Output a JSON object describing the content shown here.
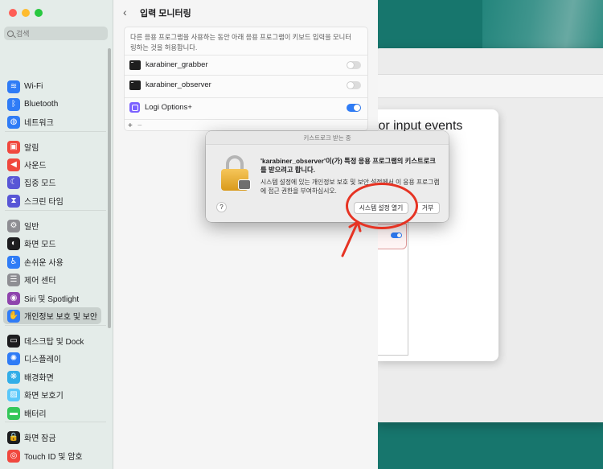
{
  "background": {
    "sheet_title": "tor input events"
  },
  "sidebar": {
    "search_placeholder": "검색",
    "items": [
      {
        "label": "Wi-Fi",
        "icon": "wifi-icon",
        "color": "#2f7cf6",
        "glyph": "≋"
      },
      {
        "label": "Bluetooth",
        "icon": "bluetooth-icon",
        "color": "#2f7cf6",
        "glyph": "ᛒ"
      },
      {
        "label": "네트워크",
        "icon": "network-icon",
        "color": "#2f7cf6",
        "glyph": "◍"
      },
      {
        "label": "알림",
        "icon": "notifications-icon",
        "color": "#f0483e",
        "glyph": "▣"
      },
      {
        "label": "사운드",
        "icon": "sound-icon",
        "color": "#f0483e",
        "glyph": "◀"
      },
      {
        "label": "집중 모드",
        "icon": "focus-icon",
        "color": "#5856d6",
        "glyph": "☾"
      },
      {
        "label": "스크린 타임",
        "icon": "screen-time-icon",
        "color": "#5856d6",
        "glyph": "⧗"
      },
      {
        "label": "일반",
        "icon": "general-icon",
        "color": "#8e8e93",
        "glyph": "⚙"
      },
      {
        "label": "화면 모드",
        "icon": "appearance-icon",
        "color": "#1d1d1f",
        "glyph": "◐"
      },
      {
        "label": "손쉬운 사용",
        "icon": "accessibility-icon",
        "color": "#2f7cf6",
        "glyph": "♿"
      },
      {
        "label": "제어 센터",
        "icon": "control-center-icon",
        "color": "#8e8e93",
        "glyph": "☰"
      },
      {
        "label": "Siri 및 Spotlight",
        "icon": "siri-icon",
        "color": "#8e44ad",
        "glyph": "◉"
      },
      {
        "label": "개인정보 보호 및 보안",
        "icon": "privacy-hand-icon",
        "color": "#2f7cf6",
        "glyph": "✋"
      },
      {
        "label": "데스크탑 및 Dock",
        "icon": "desktop-dock-icon",
        "color": "#1d1d1f",
        "glyph": "▭"
      },
      {
        "label": "디스플레이",
        "icon": "display-icon",
        "color": "#2f7cf6",
        "glyph": "✺"
      },
      {
        "label": "배경화면",
        "icon": "wallpaper-icon",
        "color": "#32aee8",
        "glyph": "❋"
      },
      {
        "label": "화면 보호기",
        "icon": "screensaver-icon",
        "color": "#5ac8fa",
        "glyph": "▨"
      },
      {
        "label": "배터리",
        "icon": "battery-icon",
        "color": "#34c759",
        "glyph": "▬"
      },
      {
        "label": "화면 잠금",
        "icon": "lock-screen-icon",
        "color": "#1d1d1f",
        "glyph": "🔒"
      },
      {
        "label": "Touch ID 및 암호",
        "icon": "touch-id-icon",
        "color": "#f0483e",
        "glyph": "◎"
      }
    ]
  },
  "main": {
    "title": "입력 모니터링",
    "description": "다른 응용 프로그램을 사용하는 동안 아래 응용 프로그램이 키보드 입력을 모니터링하는 것을 허용합니다.",
    "apps": [
      {
        "name": "karabiner_grabber",
        "enabled": false
      },
      {
        "name": "karabiner_observer",
        "enabled": false
      },
      {
        "name": "Logi Options+",
        "enabled": true
      }
    ],
    "add_label": "+",
    "remove_label": "−"
  },
  "dialog": {
    "title": "키스트로크 받는 중",
    "heading": "'karabiner_observer'이(가) 특정 응용 프로그램의 키스트로크를 받으려고 합니다.",
    "body": "시스템 설정에 있는 개인정보 보호 및 보안 설정에서 이 응용 프로그램에 접근 권한을 부여하십시오.",
    "help_label": "?",
    "open_settings_label": "시스템 설정 열기",
    "deny_label": "거부"
  },
  "colors": {
    "accent": "#2f7cf6",
    "annotation": "#e63323",
    "desktop": "#17766d"
  }
}
